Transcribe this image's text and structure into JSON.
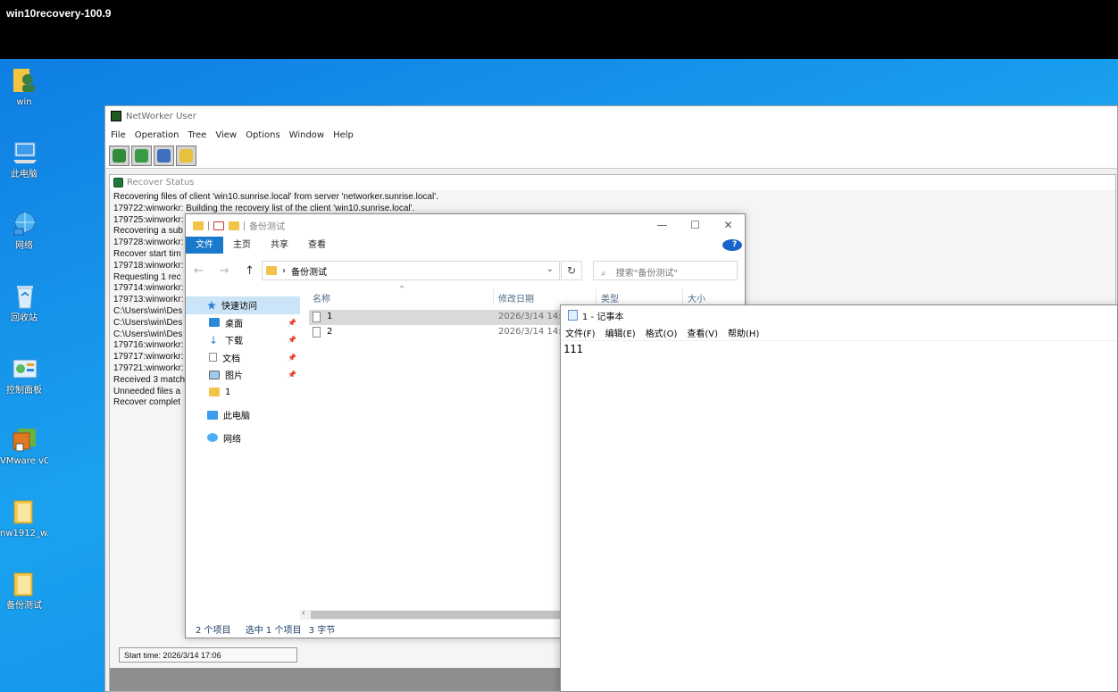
{
  "session_title": "win10recovery-100.9",
  "desktop_icons": [
    {
      "label": "win",
      "icon": "user-folder-icon"
    },
    {
      "label": "此电脑",
      "icon": "computer-icon"
    },
    {
      "label": "网络",
      "icon": "network-icon"
    },
    {
      "label": "回收站",
      "icon": "recycle-bin-icon"
    },
    {
      "label": "控制面板",
      "icon": "control-panel-icon"
    },
    {
      "label": "VMware vCenter C...",
      "icon": "vmware-icon"
    },
    {
      "label": "nw1912_w...",
      "icon": "folder-icon"
    },
    {
      "label": "备份测试",
      "icon": "folder-icon"
    }
  ],
  "networker": {
    "title": "NetWorker User",
    "menu": [
      "File",
      "Operation",
      "Tree",
      "View",
      "Options",
      "Window",
      "Help"
    ],
    "toolbar": [
      "recover-icon",
      "backup-icon",
      "verify-icon",
      "check-icon"
    ],
    "recover_status": {
      "title": "Recover Status",
      "log": [
        "Recovering files of client 'win10.sunrise.local' from server 'networker.sunrise.local'.",
        "179722:winworkr: Building the recovery list of the client 'win10.sunrise.local'.",
        "179725:winworkr:",
        "Recovering a sub",
        "179728:winworkr:",
        "Recover start tim",
        "179718:winworkr:",
        "Requesting 1 rec",
        "179714:winworkr:",
        "179713:winworkr:",
        "C:\\Users\\win\\Des",
        "C:\\Users\\win\\Des",
        "C:\\Users\\win\\Des",
        "179716:winworkr:",
        "179717:winworkr:",
        "179721:winworkr:",
        "Received 3 match",
        "Unneeded files a",
        "Recover complet"
      ],
      "status_text": "Start time: 2026/3/14 17:06"
    }
  },
  "explorer": {
    "title": "备份测试",
    "window_controls": [
      "—",
      "☐",
      "✕"
    ],
    "ribbon": [
      "文件",
      "主页",
      "共享",
      "查看"
    ],
    "address": "备份测试",
    "search_placeholder": "搜索\"备份测试\"",
    "sidebar": [
      {
        "label": "快速访问",
        "icon": "star-icon",
        "pinned": false
      },
      {
        "label": "桌面",
        "icon": "desktop-icon",
        "pinned": true
      },
      {
        "label": "下载",
        "icon": "download-icon",
        "pinned": true
      },
      {
        "label": "文档",
        "icon": "document-icon",
        "pinned": true
      },
      {
        "label": "图片",
        "icon": "picture-icon",
        "pinned": true
      },
      {
        "label": "1",
        "icon": "folder-icon",
        "pinned": false
      },
      {
        "label": "此电脑",
        "icon": "computer-icon",
        "pinned": false
      },
      {
        "label": "网络",
        "icon": "network-icon",
        "pinned": false
      }
    ],
    "columns": [
      "名称",
      "修改日期",
      "类型",
      "大小"
    ],
    "rows": [
      {
        "name": "1",
        "modified": "2026/3/14 14:4",
        "selected": true
      },
      {
        "name": "2",
        "modified": "2026/3/14 14:4",
        "selected": false
      }
    ],
    "status": [
      "2 个项目",
      "选中 1 个项目",
      "3 字节"
    ]
  },
  "notepad": {
    "title": "1 - 记事本",
    "menu": [
      "文件(F)",
      "编辑(E)",
      "格式(O)",
      "查看(V)",
      "帮助(H)"
    ],
    "content": "111"
  }
}
